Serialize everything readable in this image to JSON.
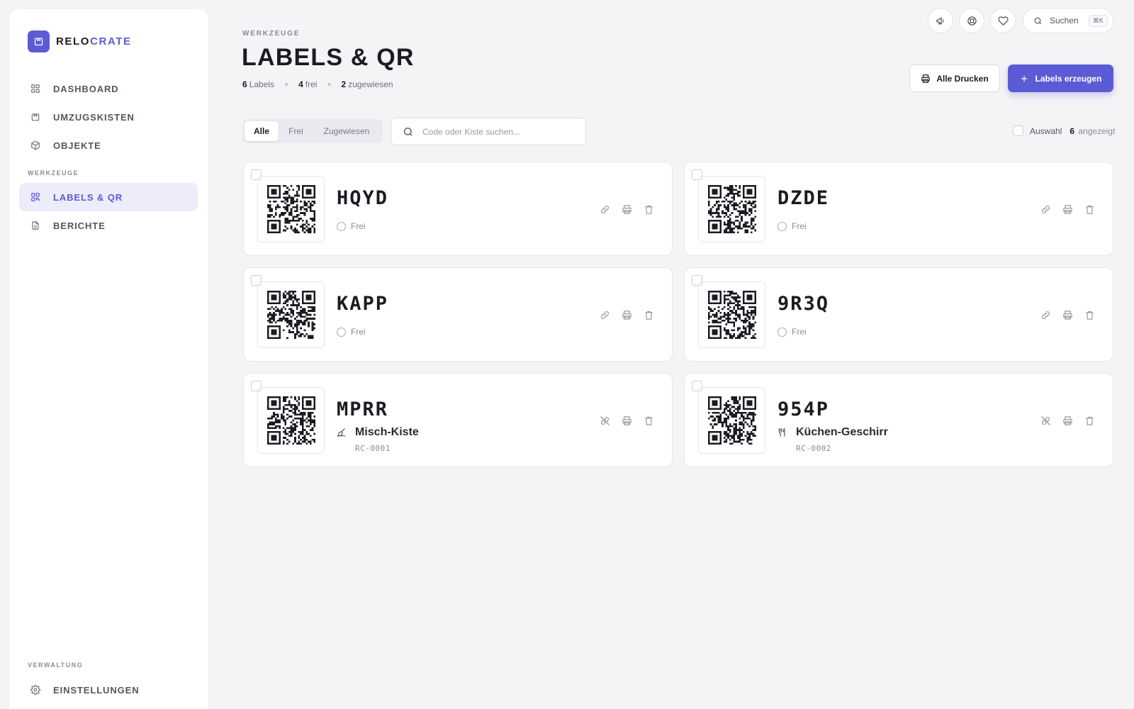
{
  "brand": {
    "name_part1": "RELO",
    "name_part2": "CRATE",
    "accent": "#5b5bd6"
  },
  "sidebar": {
    "items": [
      {
        "label": "DASHBOARD",
        "icon": "grid-icon"
      },
      {
        "label": "UMZUGSKISTEN",
        "icon": "box-icon"
      },
      {
        "label": "OBJEKTE",
        "icon": "cube-icon"
      }
    ],
    "section_tools": "WERKZEUGE",
    "tools": [
      {
        "label": "LABELS & QR",
        "icon": "qr-icon",
        "active": true
      },
      {
        "label": "BERICHTE",
        "icon": "document-icon"
      }
    ],
    "section_admin": "VERWALTUNG",
    "admin": [
      {
        "label": "EINSTELLUNGEN",
        "icon": "gear-icon"
      }
    ]
  },
  "topbar": {
    "search_label": "Suchen",
    "search_shortcut": "⌘K"
  },
  "header": {
    "eyebrow": "WERKZEUGE",
    "title": "LABELS & QR",
    "stat_labels_count": "6",
    "stat_labels_text": "Labels",
    "stat_free_count": "4",
    "stat_free_text": "frei",
    "stat_assigned_count": "2",
    "stat_assigned_text": "zugewiesen",
    "btn_print_all": "Alle Drucken",
    "btn_create": "Labels erzeugen"
  },
  "filters": {
    "tabs": [
      "Alle",
      "Frei",
      "Zugewiesen"
    ],
    "active_tab": "Alle",
    "search_placeholder": "Code oder Kiste suchen...",
    "select_label": "Auswahl",
    "shown_count": "6",
    "shown_text": "angezeigt"
  },
  "labels": [
    {
      "code": "HQYD",
      "status": "Frei"
    },
    {
      "code": "DZDE",
      "status": "Frei"
    },
    {
      "code": "KAPP",
      "status": "Frei"
    },
    {
      "code": "9R3Q",
      "status": "Frei"
    },
    {
      "code": "MPRR",
      "crate_name": "Misch-Kiste",
      "crate_id": "RC-0001",
      "crate_icon": "broom-icon"
    },
    {
      "code": "954P",
      "crate_name": "Küchen-Geschirr",
      "crate_id": "RC-0002",
      "crate_icon": "utensils-icon"
    }
  ]
}
